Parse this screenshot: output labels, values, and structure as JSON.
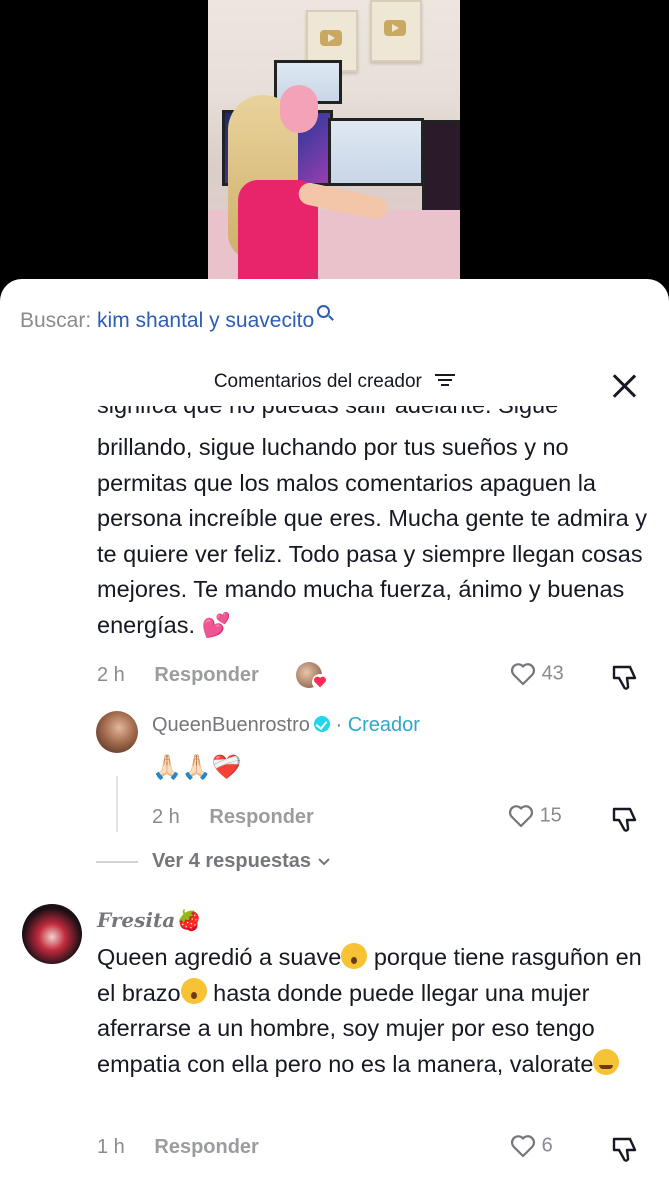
{
  "search": {
    "label": "Buscar:",
    "query": "kim shantal y suavecito"
  },
  "panel": {
    "title": "Comentarios del creador"
  },
  "comments": [
    {
      "partial_line": "signifca que no puedas salir adelante. Sigue",
      "text": "brillando, sigue luchando por tus sueños y no permitas que los malos comentarios apaguen la persona increíble que eres. Mucha gente te admira y te quiere ver feliz. Todo pasa y siempre llegan cosas mejores. Te mando mucha fuerza, ánimo y buenas energías. 💕",
      "time": "2 h",
      "reply_label": "Responder",
      "likes": "43",
      "reply": {
        "author": "QueenBuenrostro",
        "badge": "Creador",
        "separator": "·",
        "text": "🙏🏻🙏🏻❤️‍🩹",
        "time": "2 h",
        "reply_label": "Responder",
        "likes": "15"
      },
      "more_replies": "Ver 4 respuestas"
    },
    {
      "author": "Fresita🍓",
      "text_parts": [
        "Queen agredió a suave",
        " porque tiene rasguñon en el brazo",
        " hasta donde puede llegar una mujer aferrarse a un hombre, soy mujer por eso tengo empatia con ella pero no es la manera, valorate"
      ],
      "time": "1 h",
      "reply_label": "Responder",
      "likes": "6"
    }
  ],
  "colors": {
    "accent_blue": "#2b5db5",
    "creator": "#2fa8c9",
    "muted": "#8a8b91"
  }
}
